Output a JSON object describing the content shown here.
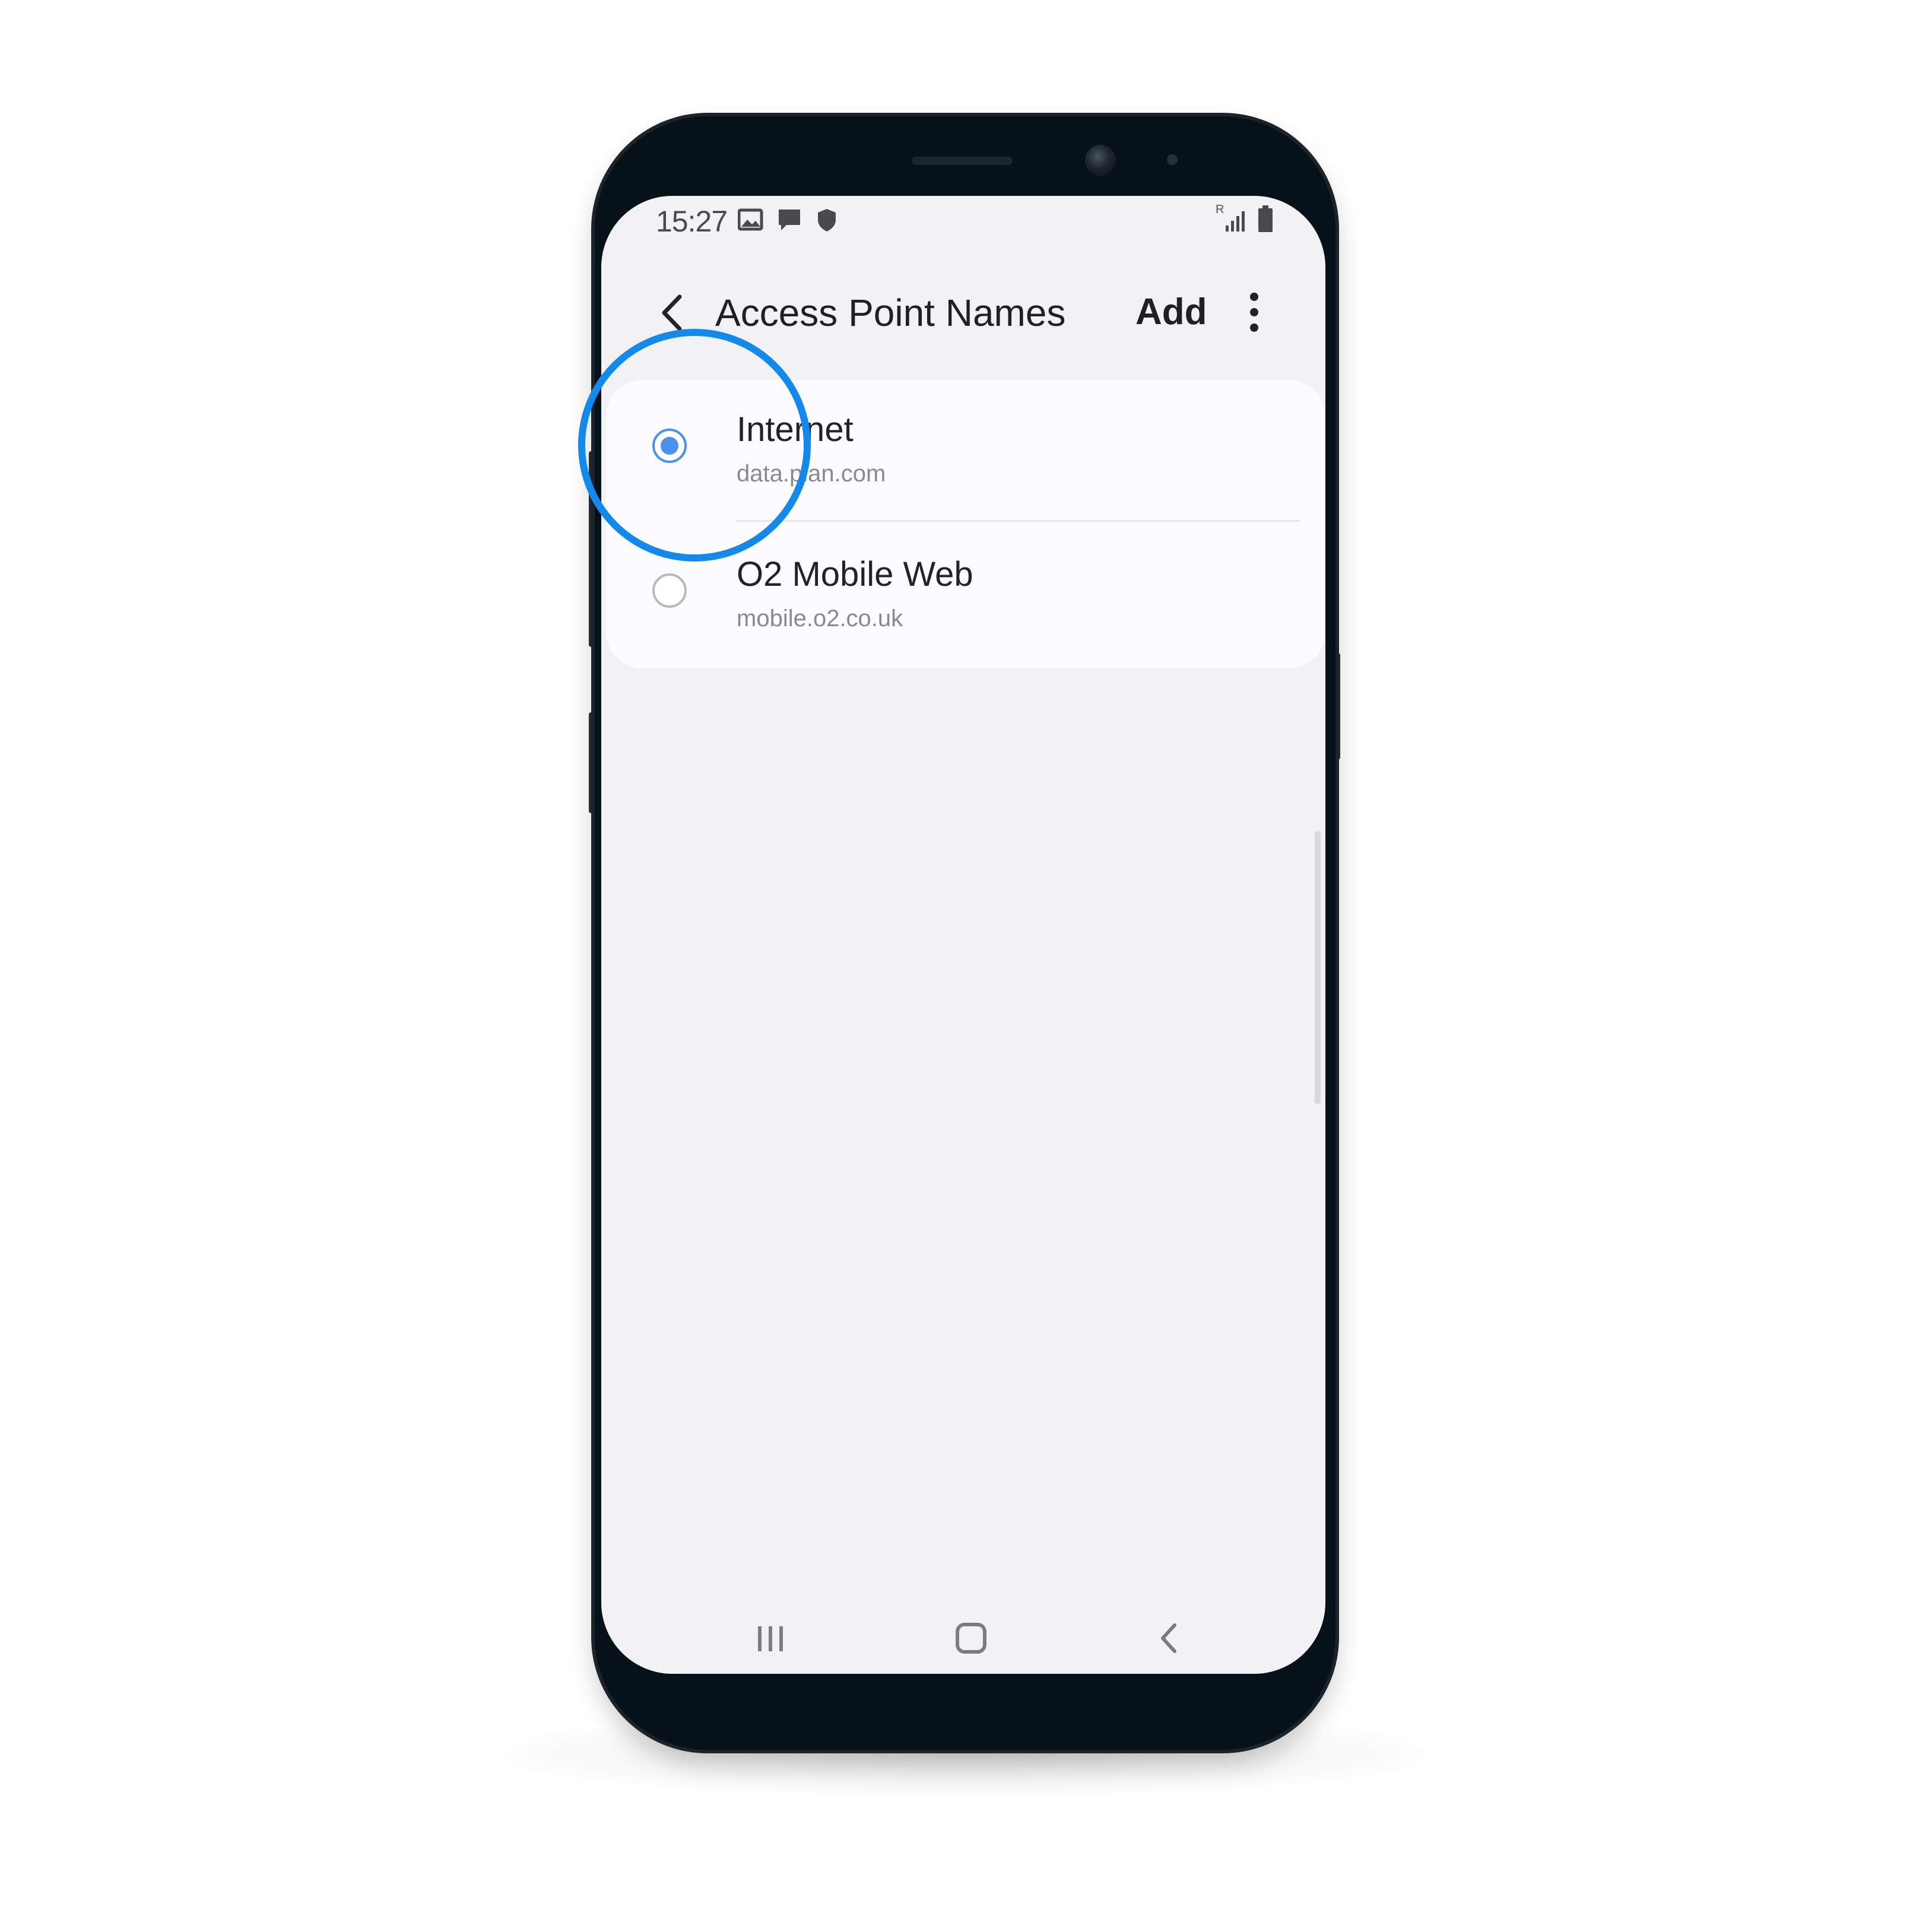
{
  "status_bar": {
    "time": "15:27",
    "icons": [
      "image-icon",
      "message-icon",
      "shield-icon"
    ],
    "right_icons": [
      "signal-icon",
      "battery-icon"
    ],
    "signal_label": "R"
  },
  "app_bar": {
    "title": "Access Point Names",
    "add_label": "Add",
    "back_icon": "back-chevron-icon",
    "more_icon": "more-vertical-icon"
  },
  "apn_list": [
    {
      "name": "Internet",
      "apn": "data.plan.com",
      "selected": true
    },
    {
      "name": "O2 Mobile Web",
      "apn": "mobile.o2.co.uk",
      "selected": false
    }
  ],
  "nav_bar": {
    "buttons": [
      "recents-icon",
      "home-icon",
      "back-icon"
    ]
  },
  "colors": {
    "accent": "#4b90ee",
    "highlight": "#138aeb",
    "screen_bg": "#f2f1f4",
    "card_bg": "#fcfbfd",
    "phone_body": "#07111a"
  }
}
